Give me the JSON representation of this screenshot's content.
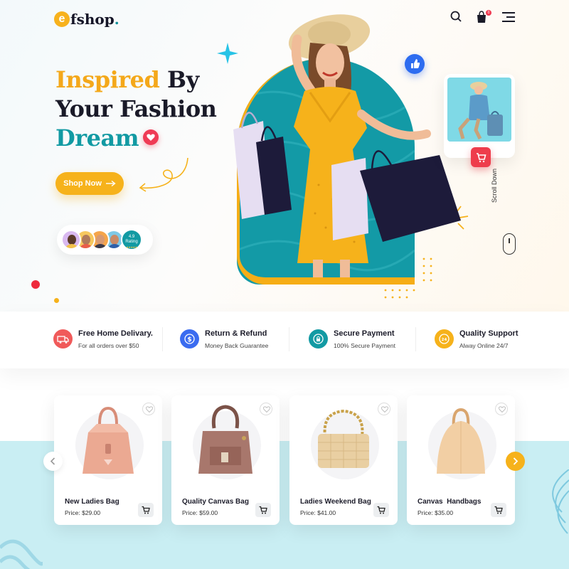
{
  "header": {
    "logo_letter": "e",
    "logo_text": "fshop",
    "logo_dot": ".",
    "cart_count": "0"
  },
  "hero": {
    "headline_word1": "Inspired",
    "headline_word2": "By",
    "headline_line2": "Your Fashion",
    "headline_line3": "Dream",
    "cta_label": "Shop Now",
    "rating_value": "4.9",
    "rating_label": "Rating",
    "scroll_label": "Scroll Down"
  },
  "features": [
    {
      "title": "Free Home Delivary.",
      "subtitle": "For all orders over $50",
      "color": "#f05a5a",
      "icon": "truck-icon"
    },
    {
      "title": "Return & Refund",
      "subtitle": "Money Back Guarantee",
      "color": "#3b6cf0",
      "icon": "dollar-icon"
    },
    {
      "title": "Secure Payment",
      "subtitle": "100% Secure Payment",
      "color": "#129aa3",
      "icon": "lock-icon"
    },
    {
      "title": "Quality Support",
      "subtitle": "Alway Online 24/7",
      "color": "#f6b21b",
      "icon": "support-icon"
    }
  ],
  "products": [
    {
      "name": "New Ladies Bag",
      "price": "Price: $29.00",
      "color": "#eba992"
    },
    {
      "name": "Quality Canvas Bag",
      "price": "Price: $59.00",
      "color": "#a8776c"
    },
    {
      "name": "Ladies Weekend Bag",
      "price": "Price: $41.00",
      "color": "#e9cfa2"
    },
    {
      "name": "Canvas  Handbags",
      "price": "Price: $35.00",
      "color": "#f2cfa4"
    }
  ],
  "colors": {
    "accent_orange": "#f6b21b",
    "accent_teal": "#129aa3",
    "accent_red": "#ef3b55"
  }
}
